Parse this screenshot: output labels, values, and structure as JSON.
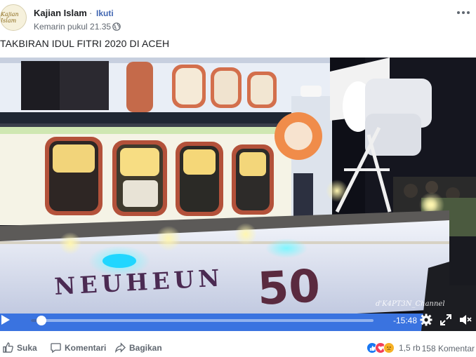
{
  "post": {
    "page_name": "Kajian Islam",
    "separator": "·",
    "follow_label": "Ikuti",
    "time": "Kemarin pukul 21.35 ·",
    "text": "TAKBIRAN IDUL FITRI 2020 DI ACEH",
    "avatar_text": "Kajian Islam"
  },
  "video": {
    "boat_name": "NEUHEUN",
    "boat_number": "50",
    "watermark": "d'K4PT3N_Channel",
    "time_remaining": "-15:48",
    "progress": 0.03,
    "icons": [
      "play-icon",
      "settings-gear-icon",
      "fullscreen-icon",
      "volume-mute-icon"
    ]
  },
  "actions": {
    "like_label": "Suka",
    "comment_label": "Komentari",
    "share_label": "Bagikan",
    "reactions_count": "1,5 rb",
    "comments_count": "158 Komentar"
  },
  "colors": {
    "link_blue": "#4267b2",
    "muted_text": "#606770",
    "like_blue": "#1877f2",
    "love_red": "#f33e58",
    "sad_yellow": "#f7b125"
  }
}
